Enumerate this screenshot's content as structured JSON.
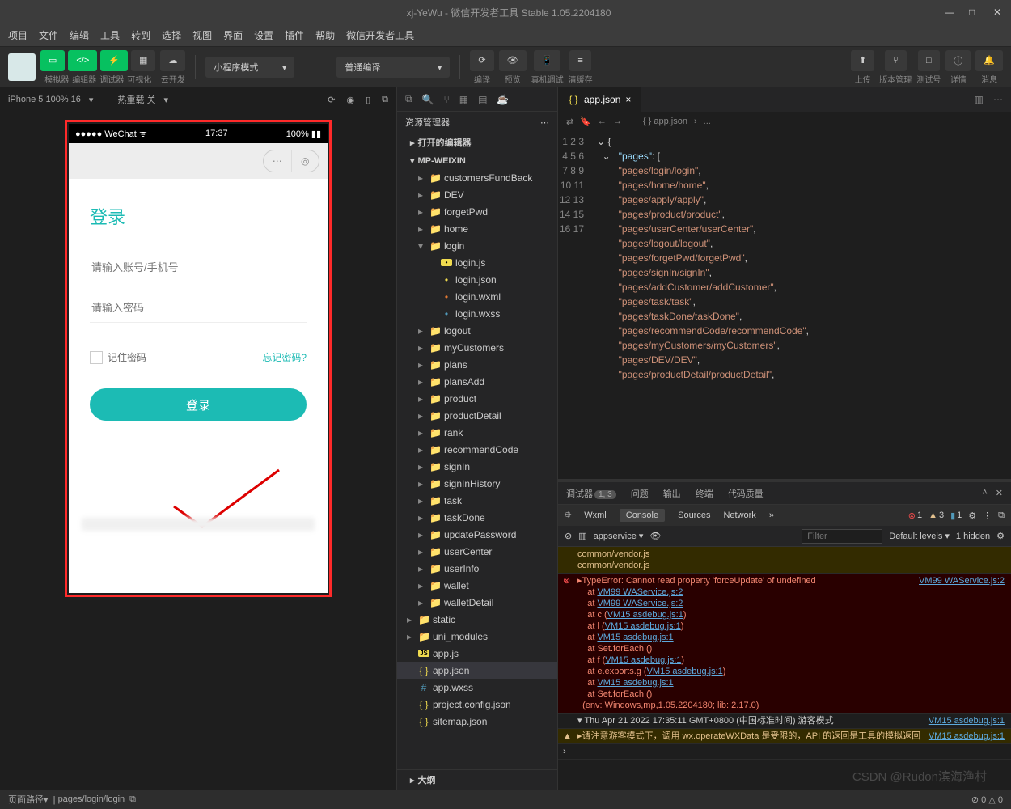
{
  "window": {
    "title_project": "xj-YeWu",
    "title_app": "微信开发者工具 Stable 1.05.2204180"
  },
  "menus": [
    "项目",
    "文件",
    "编辑",
    "工具",
    "转到",
    "选择",
    "视图",
    "界面",
    "设置",
    "插件",
    "帮助",
    "微信开发者工具"
  ],
  "toolbar": {
    "group1": [
      "模拟器",
      "编辑器",
      "调试器",
      "可视化"
    ],
    "cloud": "云开发",
    "mode": "小程序模式",
    "compile": "普通编译",
    "actions": [
      "编译",
      "预览",
      "真机调试",
      "清缓存"
    ],
    "right": [
      "上传",
      "版本管理",
      "测试号",
      "详情",
      "消息"
    ]
  },
  "simbar": {
    "device": "iPhone 5 100% 16",
    "reload": "热重载 关"
  },
  "phone": {
    "carrier": "●●●●● WeChat",
    "time": "17:37",
    "battery": "100%",
    "login_title": "登录",
    "ph_user": "请输入账号/手机号",
    "ph_pwd": "请输入密码",
    "remember": "记住密码",
    "forgot": "忘记密码?",
    "login_btn": "登录"
  },
  "explorer": {
    "title": "资源管理器",
    "open_editors": "打开的编辑器",
    "project": "MP-WEIXIN",
    "folders_top": [
      "customersFundBack",
      "DEV",
      "forgetPwd",
      "home"
    ],
    "login_folder": "login",
    "login_files": [
      "login.js",
      "login.json",
      "login.wxml",
      "login.wxss"
    ],
    "folders_after": [
      "logout",
      "myCustomers",
      "plans",
      "plansAdd",
      "product",
      "productDetail",
      "rank",
      "recommendCode",
      "signIn",
      "signInHistory",
      "task",
      "taskDone",
      "updatePassword",
      "userCenter",
      "userInfo",
      "wallet",
      "walletDetail"
    ],
    "static": "static",
    "uni": "uni_modules",
    "root_files": [
      "app.js",
      "app.json",
      "app.wxss",
      "project.config.json",
      "sitemap.json"
    ],
    "outline": "大纲"
  },
  "editor": {
    "tab": "app.json",
    "breadcrumb": [
      "{ } app.json",
      "..."
    ],
    "key": "\"pages\"",
    "lines": [
      "\"pages/login/login\",",
      "\"pages/home/home\",",
      "\"pages/apply/apply\",",
      "\"pages/product/product\",",
      "\"pages/userCenter/userCenter\",",
      "\"pages/logout/logout\",",
      "\"pages/forgetPwd/forgetPwd\",",
      "\"pages/signIn/signIn\",",
      "\"pages/addCustomer/addCustomer\",",
      "\"pages/task/task\",",
      "\"pages/taskDone/taskDone\",",
      "\"pages/recommendCode/recommendCode\",",
      "\"pages/myCustomers/myCustomers\",",
      "\"pages/DEV/DEV\",",
      "\"pages/productDetail/productDetail\","
    ]
  },
  "debugger": {
    "tabs": [
      "调试器",
      "问题",
      "输出",
      "终端",
      "代码质量"
    ],
    "badge": "1, 3",
    "devtabs": [
      "Wxml",
      "Console",
      "Sources",
      "Network"
    ],
    "status": {
      "e": "1",
      "w": "3",
      "i": "1"
    },
    "filter_ctx": "appservice",
    "filter_ph": "Filter",
    "levels": "Default levels",
    "hidden": "1 hidden",
    "log0a": "common/vendor.js",
    "log0b": "common/vendor.js",
    "err_main": "▸TypeError: Cannot read property 'forceUpdate' of undefined",
    "err_src": "VM99 WAService.js:2",
    "stack": [
      "at VM99 WAService.js:2",
      "at VM99 WAService.js:2",
      "at c (VM15 asdebug.js:1)",
      "at l (VM15 asdebug.js:1)",
      "at VM15 asdebug.js:1",
      "at Set.forEach (<anonymous>)",
      "at f (VM15 asdebug.js:1)",
      "at e.exports.g (VM15 asdebug.js:1)",
      "at VM15 asdebug.js:1",
      "at Set.forEach (<anonymous>)"
    ],
    "env": "(env: Windows,mp,1.05.2204180; lib: 2.17.0)",
    "info_time": "▾ Thu Apr 21 2022 17:35:11 GMT+0800 (中国标准时间) 游客模式",
    "info_src": "VM15 asdebug.js:1",
    "warn_msg": "▸请注意游客模式下，调用 wx.operateWXData 是受限的，API 的返回是工具的模拟返回",
    "warn_src": "VM15 asdebug.js:1"
  },
  "statusbar": {
    "label": "页面路径",
    "path": "pages/login/login",
    "errs": "⊘ 0 △ 0"
  },
  "watermark": "CSDN @Rudon滨海渔村"
}
